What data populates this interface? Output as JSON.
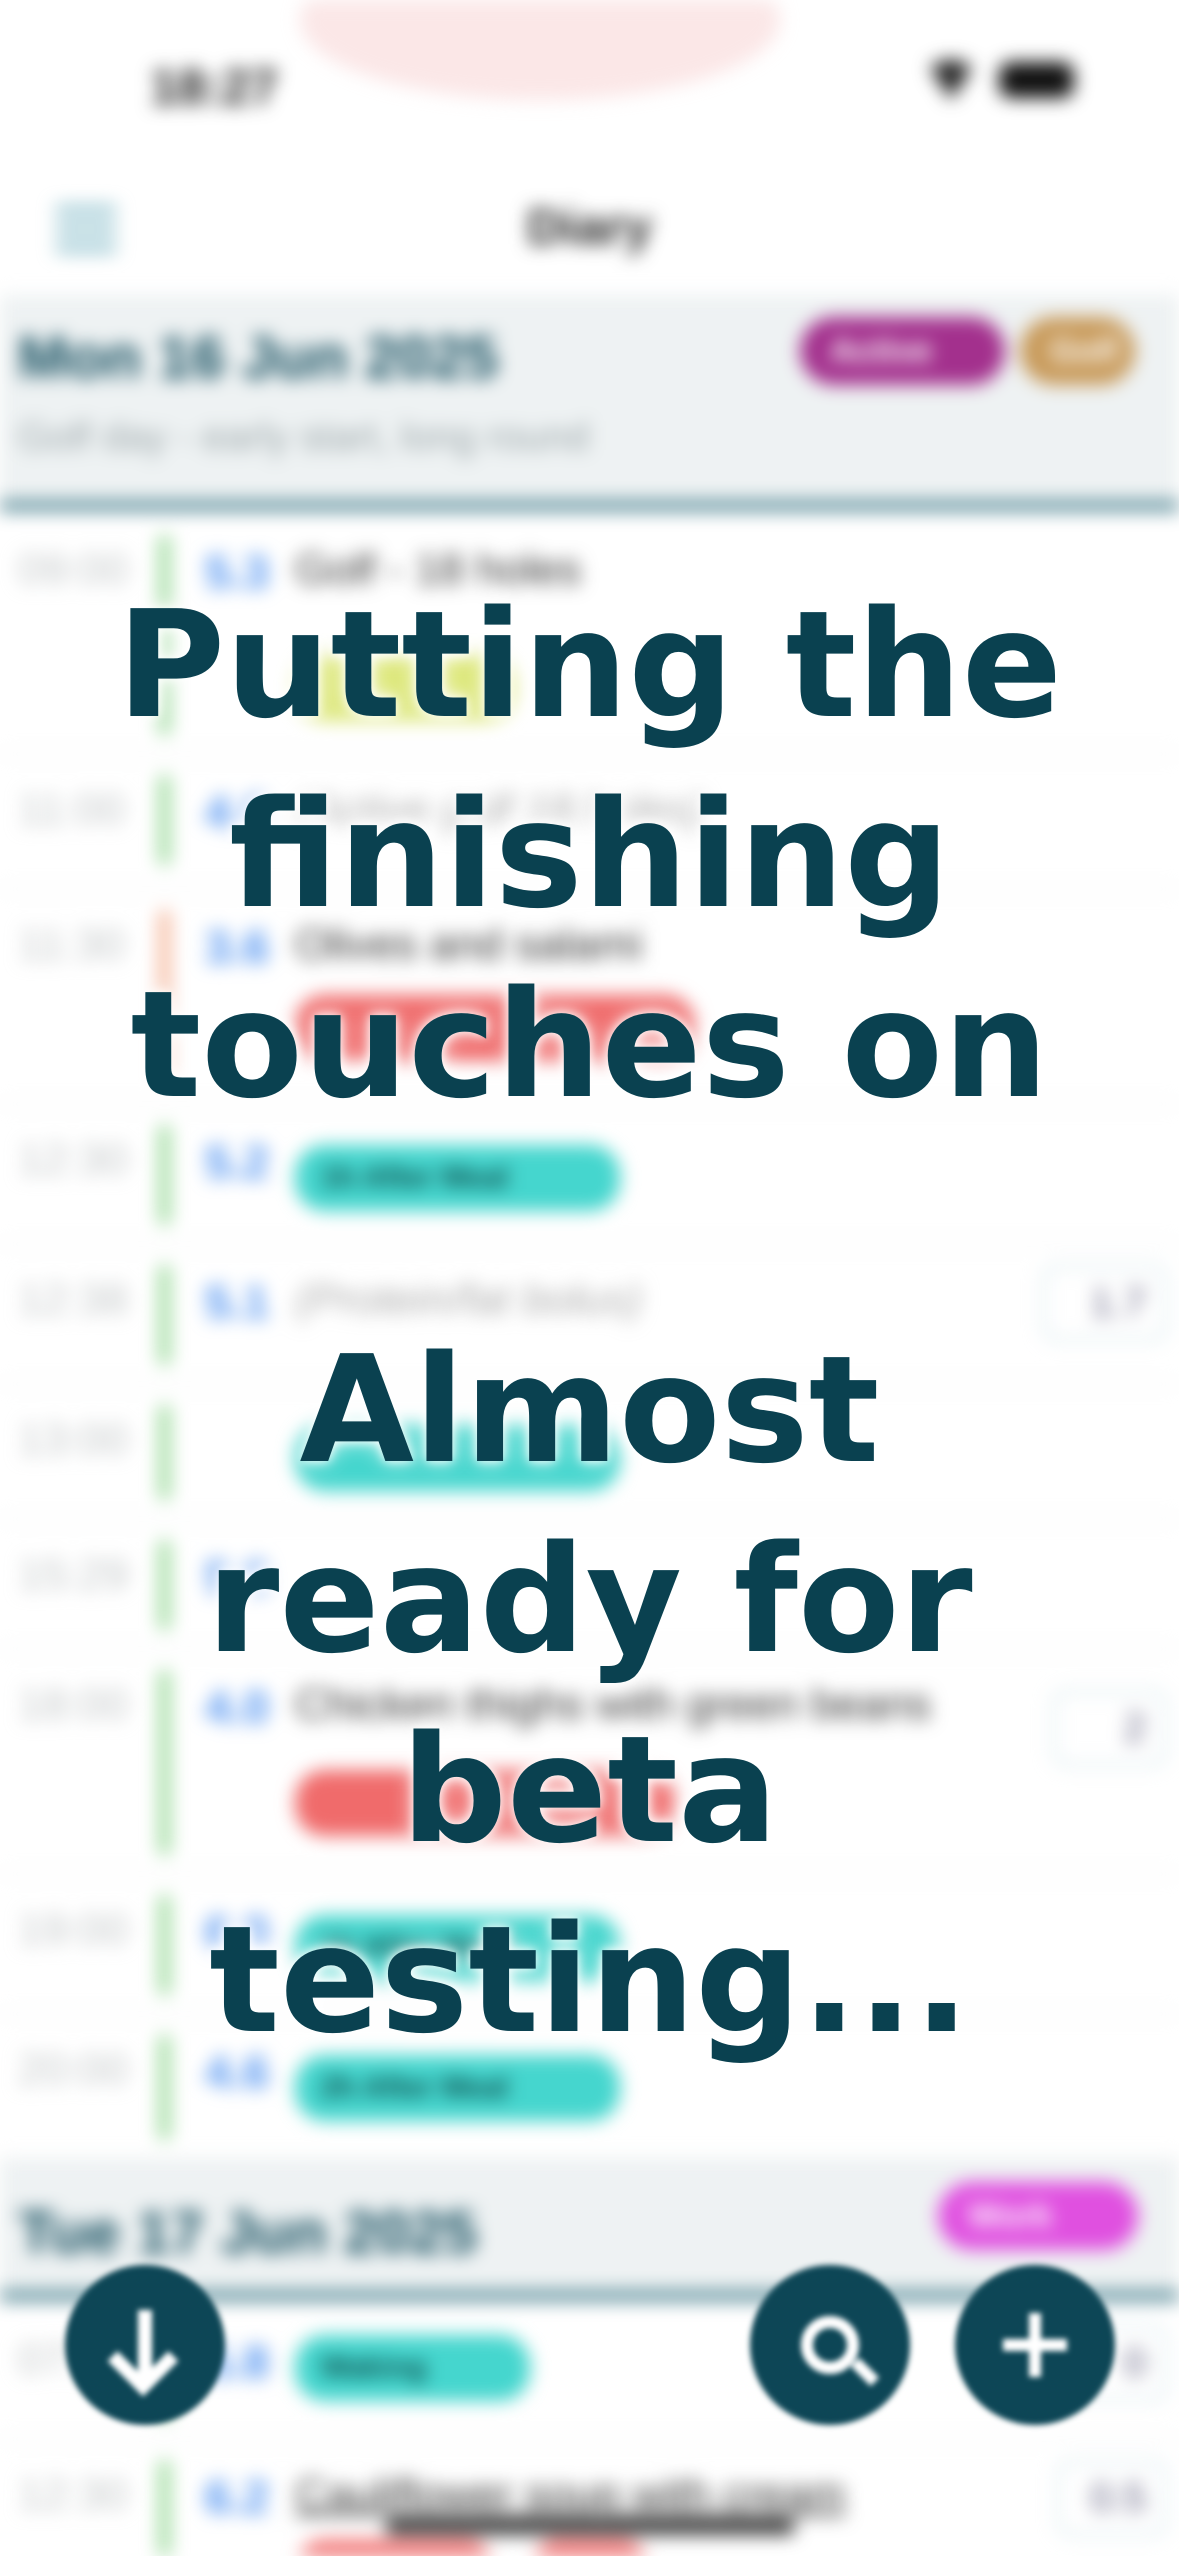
{
  "status_bar": {
    "time": "18:27"
  },
  "nav": {
    "title": "Diary"
  },
  "days": [
    {
      "date": "Mon 16 Jun 2025",
      "note": "Golf day - early start, long round",
      "badges": [
        "Active",
        "Golf"
      ],
      "entries": [
        {
          "time": "09:00",
          "bg": "5.3",
          "text": "Golf - 18 holes",
          "pill": "",
          "dose": ""
        },
        {
          "time": "11:00",
          "bg": "4.6",
          "text": "(Active golf 18 holes)",
          "pill": "",
          "dose": ""
        },
        {
          "time": "11:30",
          "bg": "3.6",
          "text": "Olives and salami",
          "pill": "",
          "dose": ""
        },
        {
          "time": "12:30",
          "bg": "5.2",
          "text": "",
          "pill": "1h After Meal",
          "dose": ""
        },
        {
          "time": "12:38",
          "bg": "5.1",
          "text": "(Protein/fat bolus)",
          "pill": "",
          "dose": "1.7"
        },
        {
          "time": "13:00",
          "bg": "",
          "text": "",
          "pill": "",
          "dose": ""
        },
        {
          "time": "15:29",
          "bg": "5.6",
          "text": "",
          "pill": "",
          "dose": ""
        },
        {
          "time": "18:00",
          "bg": "4.0",
          "text": "Chicken thighs with green beans",
          "pill": "",
          "dose": "2"
        },
        {
          "time": "19:00",
          "bg": "6.0",
          "text": "",
          "pill": "1h After Meal",
          "dose": ""
        },
        {
          "time": "20:00",
          "bg": "4.6",
          "text": "",
          "pill": "2h After Meal",
          "dose": ""
        }
      ]
    },
    {
      "date": "Tue 17 Jun 2025",
      "badges": [
        "Work"
      ],
      "entries": [
        {
          "time": "07:00",
          "bg": "5.8",
          "text": "",
          "pill": "Waking",
          "dose": "0"
        },
        {
          "time": "12:30",
          "bg": "6.2",
          "text": "Cauliflower soup with cream",
          "pill": "",
          "dose": "0.5"
        }
      ]
    }
  ],
  "overlay": {
    "line1": "Putting the finishing touches on",
    "line2": "Almost ready for beta testing..."
  },
  "colors": {
    "primary": "#0d4656",
    "accent_active": "#a3308d",
    "accent_golf": "#c89a5a",
    "accent_work": "#e050e0",
    "pill_teal": "#45d6ce"
  },
  "icons": [
    "menu-icon",
    "wifi-icon",
    "battery-icon",
    "arrow-down-icon",
    "search-icon",
    "plus-icon"
  ]
}
